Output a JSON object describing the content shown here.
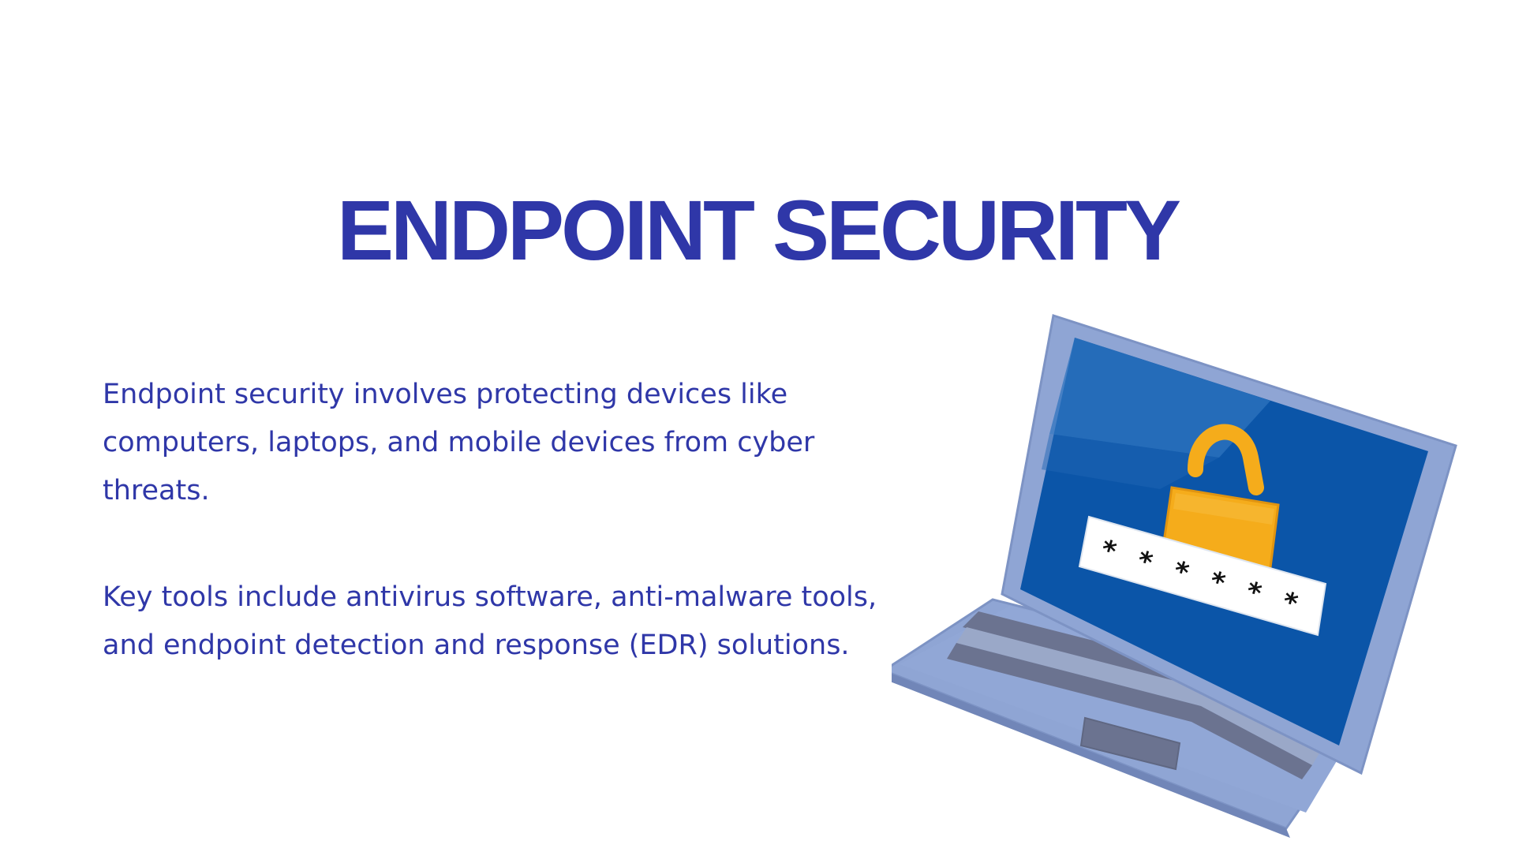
{
  "slide": {
    "title": "ENDPOINT SECURITY",
    "paragraphs": [
      "Endpoint security involves protecting devices like computers, laptops, and mobile devices from cyber threats.",
      "Key tools include antivirus software, anti-malware tools, and endpoint detection and response (EDR) solutions."
    ]
  },
  "illustration": {
    "subject": "laptop-with-padlock-and-password",
    "password_mask": "******"
  },
  "colors": {
    "text": "#2f37a8",
    "background": "#ffffff",
    "laptop_body": "#8fa5d4",
    "screen": "#0b55a8",
    "padlock": "#f5ac1b"
  }
}
